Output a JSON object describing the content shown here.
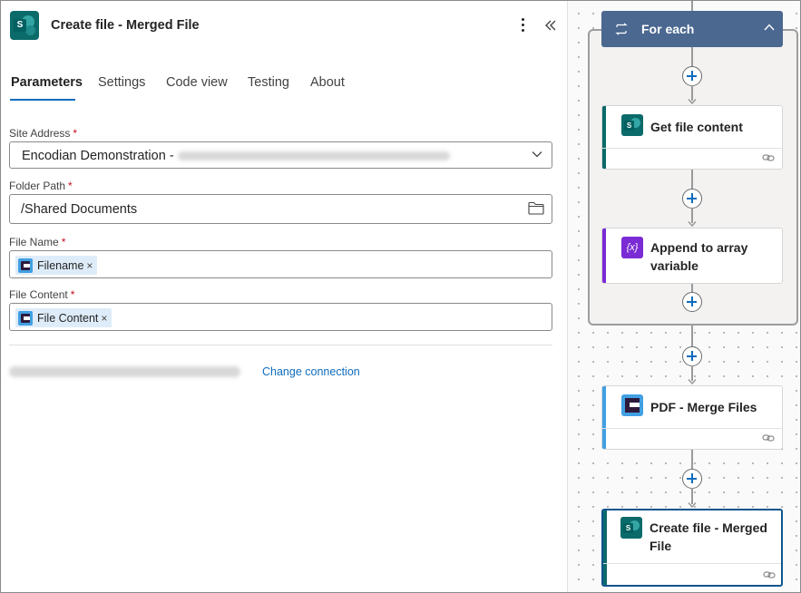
{
  "panel": {
    "title": "Create file - Merged File",
    "tabs": [
      "Parameters",
      "Settings",
      "Code view",
      "Testing",
      "About"
    ],
    "active_tab": "Parameters",
    "fields": {
      "site_address": {
        "label": "Site Address",
        "required": "*",
        "value": "Encodian Demonstration -"
      },
      "folder_path": {
        "label": "Folder Path",
        "required": "*",
        "value": "/Shared Documents"
      },
      "file_name": {
        "label": "File Name",
        "required": "*",
        "token": "Filename",
        "remove": "×"
      },
      "file_content": {
        "label": "File Content",
        "required": "*",
        "token": "File Content",
        "remove": "×"
      }
    },
    "change_connection": "Change connection"
  },
  "canvas": {
    "foreach": {
      "title": "For each"
    },
    "cards": [
      {
        "label": "Get file content",
        "icon": "sharepoint-icon"
      },
      {
        "label": "Append to array variable",
        "icon": "variable-icon",
        "icon_text": "{x}"
      },
      {
        "label": "PDF - Merge Files",
        "icon": "encodian-icon"
      },
      {
        "label": "Create file - Merged File",
        "icon": "sharepoint-icon"
      }
    ]
  },
  "colors": {
    "accent_blue": "#0f6cbd",
    "foreach_header": "#4a6890",
    "sharepoint": "#0b6a6a",
    "variable": "#7a2bd4",
    "encodian": "#41a0e3"
  }
}
